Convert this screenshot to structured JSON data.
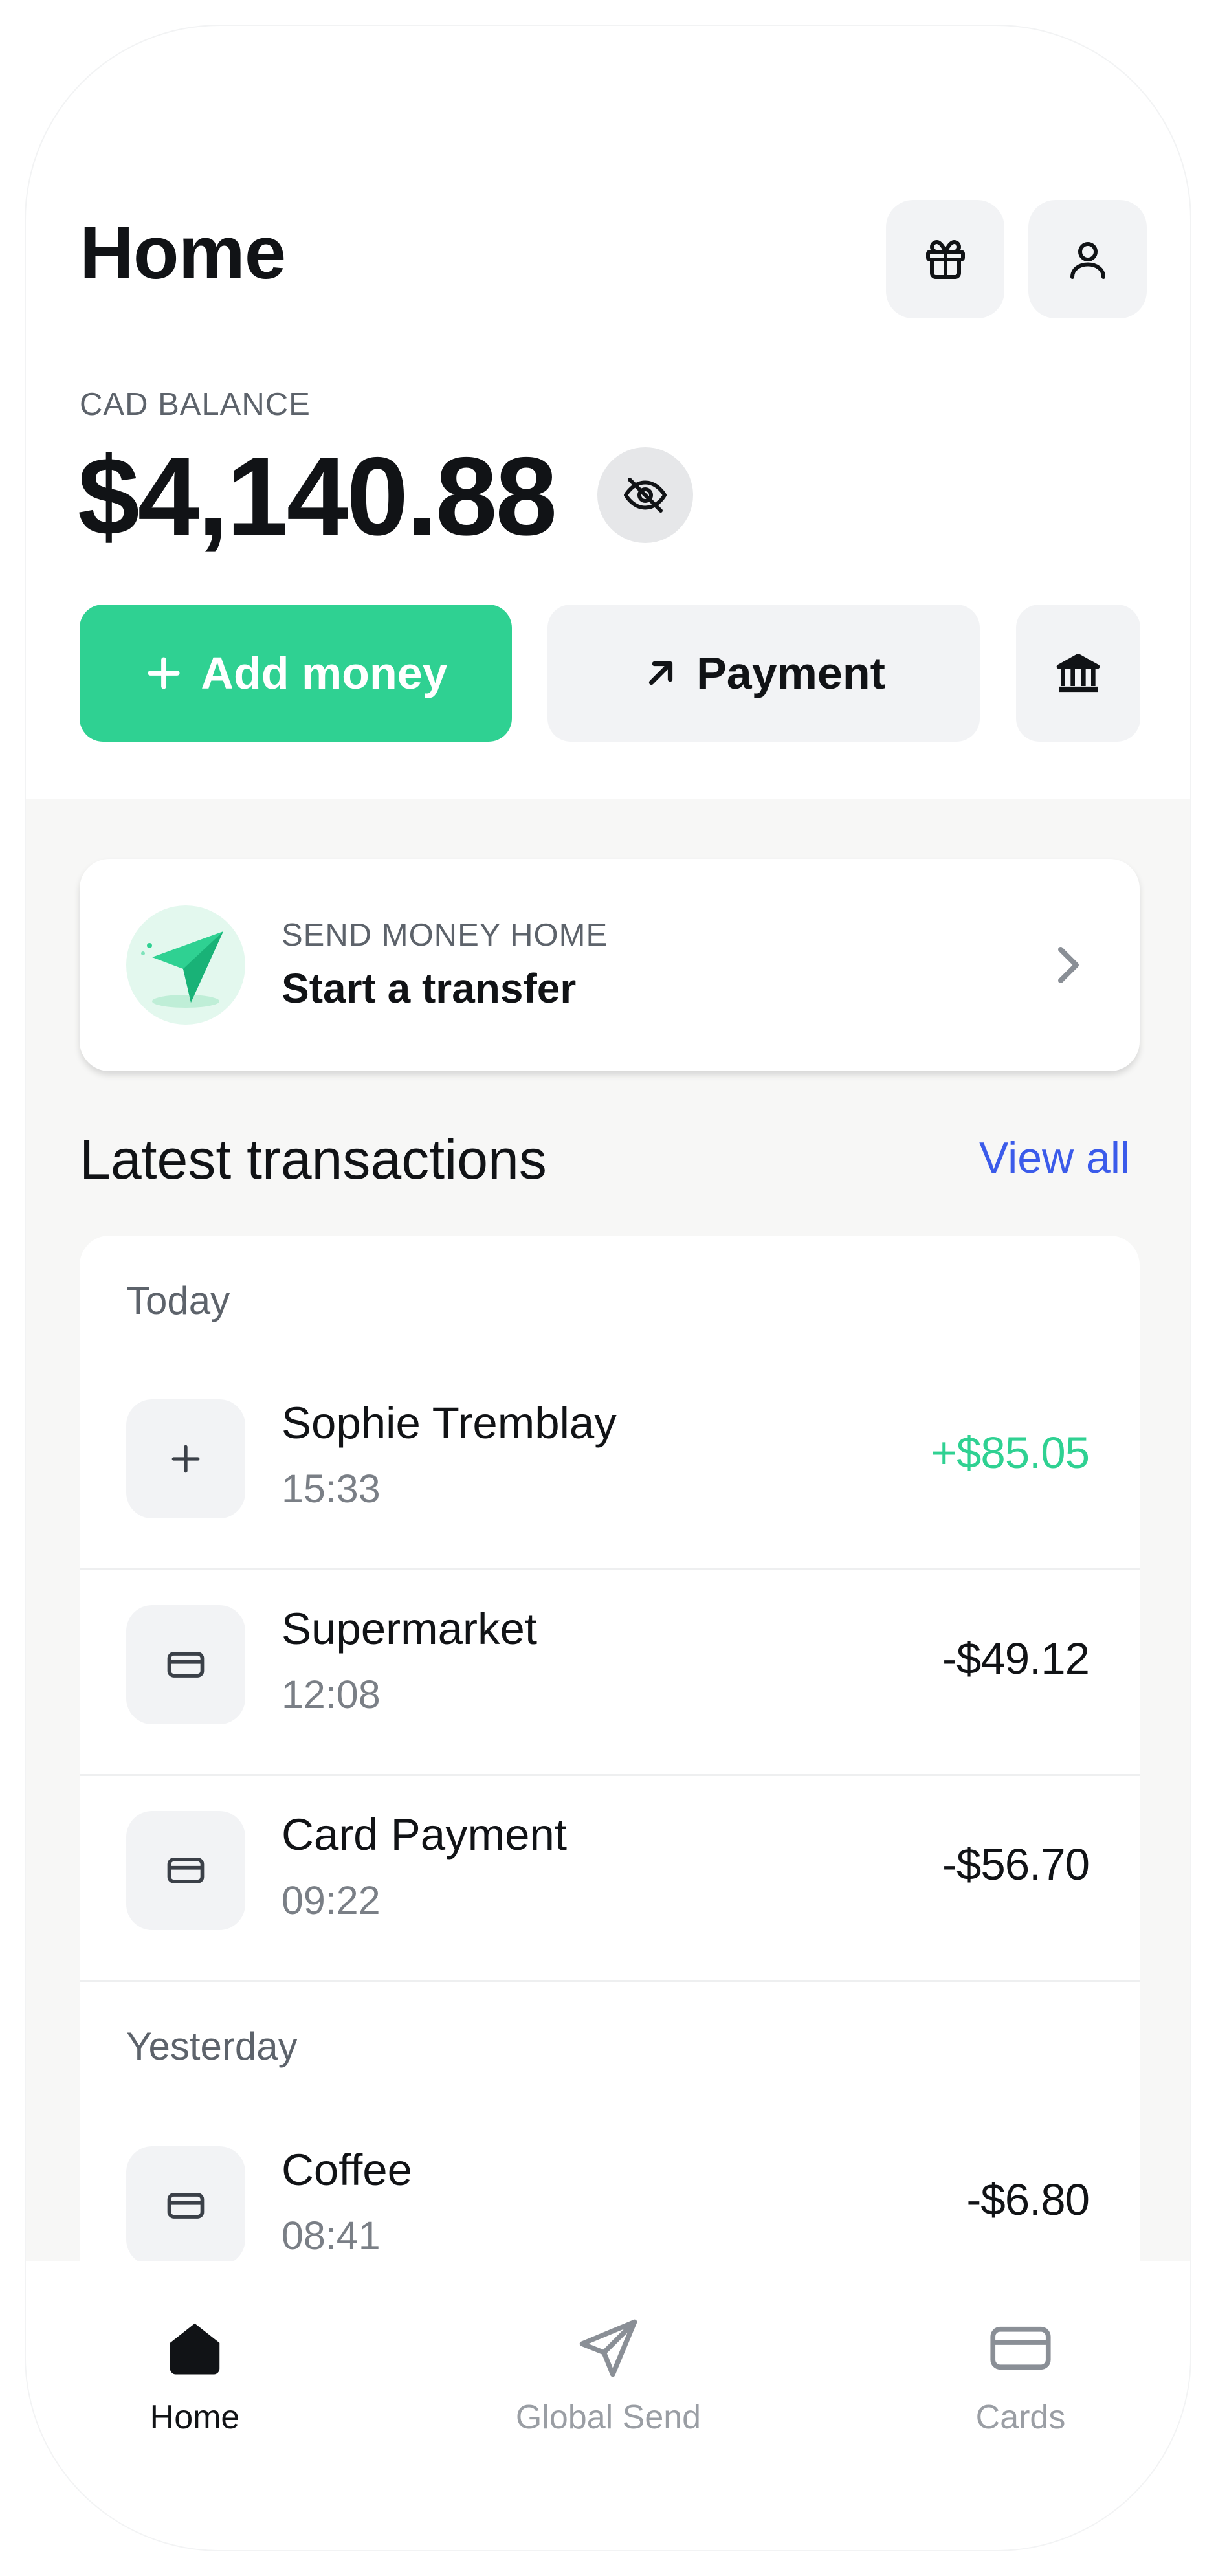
{
  "header": {
    "title": "Home"
  },
  "icons": {
    "gift": "gift-icon",
    "profile": "user-icon",
    "visibility": "eye-off-icon",
    "add": "plus-icon",
    "payment": "arrow-up-right-icon",
    "bank": "bank-icon",
    "transfer": "paper-plane-icon",
    "chevron": "chevron-right-icon",
    "card": "credit-card-icon"
  },
  "balance": {
    "label": "CAD BALANCE",
    "amount": "$4,140.88"
  },
  "actions": {
    "add_money": "Add money",
    "payment": "Payment"
  },
  "transfer_card": {
    "kicker": "SEND MONEY HOME",
    "title": "Start a transfer"
  },
  "transactions": {
    "title": "Latest transactions",
    "view_all": "View all",
    "groups": [
      {
        "label": "Today",
        "items": [
          {
            "name": "Sophie Tremblay",
            "time": "15:33",
            "amount": "+$85.05",
            "type": "incoming"
          },
          {
            "name": "Supermarket",
            "time": "12:08",
            "amount": "-$49.12",
            "type": "card"
          },
          {
            "name": "Card Payment",
            "time": "09:22",
            "amount": "-$56.70",
            "type": "card"
          }
        ]
      },
      {
        "label": "Yesterday",
        "items": [
          {
            "name": "Coffee",
            "time": "08:41",
            "amount": "-$6.80",
            "type": "card"
          }
        ]
      }
    ]
  },
  "nav": {
    "home": "Home",
    "global_send": "Global Send",
    "cards": "Cards",
    "active": "Home"
  },
  "colors": {
    "accent": "#2fd192",
    "link": "#3b5bea",
    "surface": "#f2f3f5",
    "background": "#f7f7f6",
    "text": "#111316",
    "muted": "#7a7f86"
  }
}
